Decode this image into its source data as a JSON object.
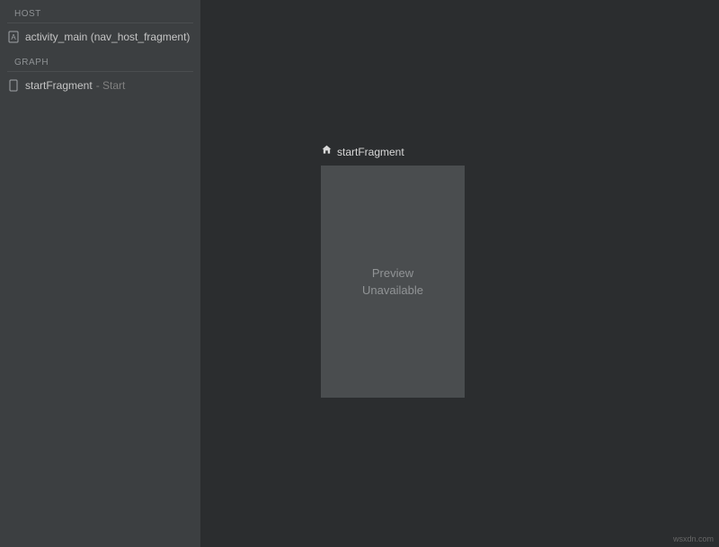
{
  "sidebar": {
    "host": {
      "header": "HOST",
      "item": {
        "label": "activity_main (nav_host_fragment)"
      }
    },
    "graph": {
      "header": "GRAPH",
      "item": {
        "label": "startFragment",
        "suffix": "- Start"
      }
    }
  },
  "canvas": {
    "fragment": {
      "title": "startFragment",
      "preview_line1": "Preview",
      "preview_line2": "Unavailable"
    }
  },
  "watermark": "wsxdn.com"
}
